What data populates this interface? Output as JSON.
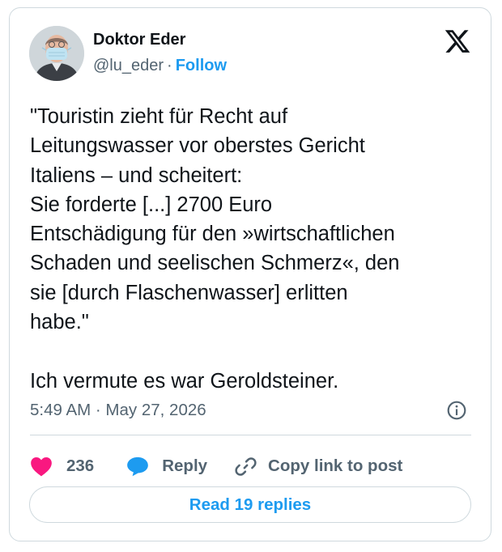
{
  "author": {
    "display_name": "Doktor Eder",
    "handle": "@lu_eder",
    "separator": "·",
    "follow_label": "Follow",
    "avatar_icon": "profile-photo-masked-man"
  },
  "platform_icon": "x-logo-icon",
  "tweet": {
    "text": "\"Touristin zieht für Recht auf\nLeitungswasser vor oberstes Gericht\nItaliens – und scheitert:\nSie forderte [...] 2700 Euro\nEntschädigung für den »wirtschaftlichen\nSchaden und seelischen Schmerz«, den\nsie [durch Flaschenwasser] erlitten\nhabe.\"\n\nIch vermute es war Geroldsteiner.",
    "timestamp": "5:49 AM · May 27, 2026"
  },
  "actions": {
    "like_count": "236",
    "reply_label": "Reply",
    "copy_link_label": "Copy link to post",
    "read_replies_label": "Read 19 replies"
  },
  "colors": {
    "accent": "#1d9bf0",
    "like": "#f91880",
    "text": "#0f1419",
    "muted": "#536471",
    "border": "#cfd9de"
  }
}
